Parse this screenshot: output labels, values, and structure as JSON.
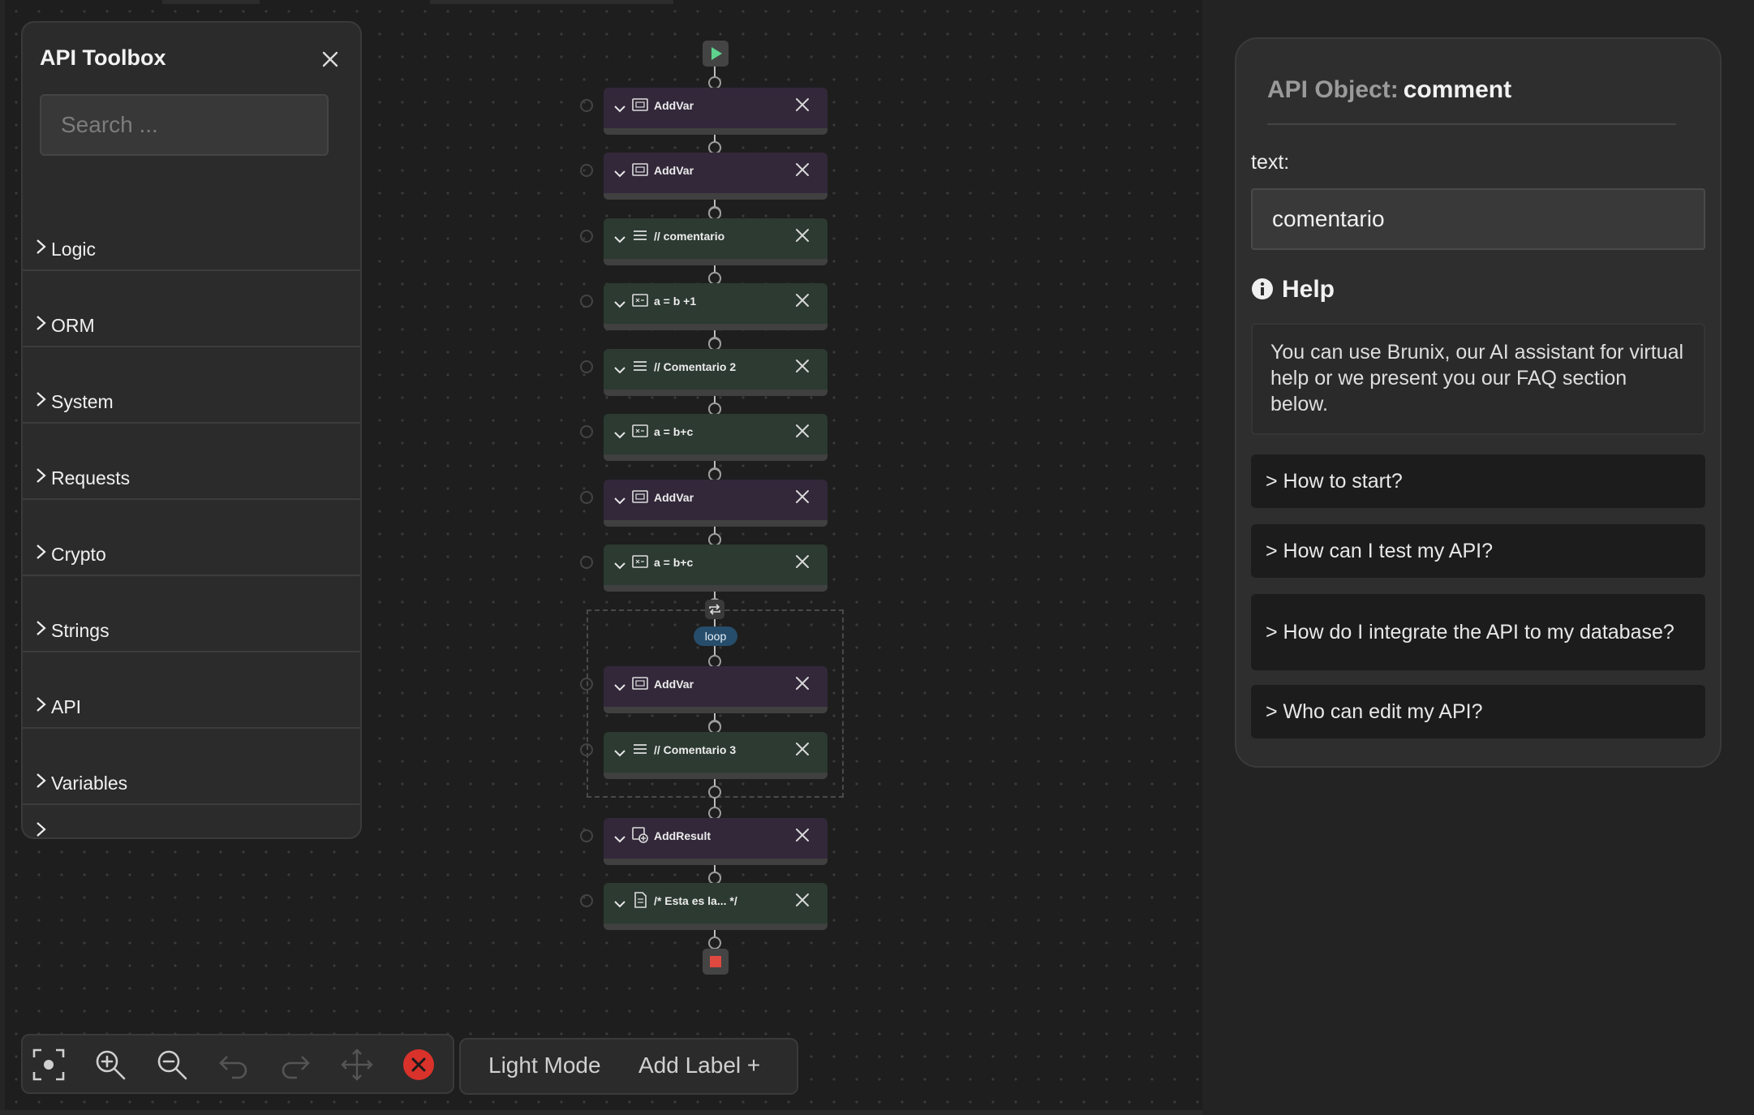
{
  "toolbox": {
    "title": "API Toolbox",
    "search_placeholder": "Search ...",
    "categories": [
      "Logic",
      "ORM",
      "System",
      "Requests",
      "Crypto",
      "Strings",
      "API",
      "Variables"
    ]
  },
  "flow": {
    "loop_label": "loop",
    "nodes": [
      {
        "label": "AddVar",
        "icon": "variable-icon",
        "color": "purple"
      },
      {
        "label": "AddVar",
        "icon": "variable-icon",
        "color": "purple"
      },
      {
        "label": "// comentario",
        "icon": "comment-lines-icon",
        "color": "green"
      },
      {
        "label": "a = b +1",
        "icon": "expression-icon",
        "color": "green"
      },
      {
        "label": "// Comentario 2",
        "icon": "comment-lines-icon",
        "color": "green"
      },
      {
        "label": "a = b+c",
        "icon": "expression-icon",
        "color": "green"
      },
      {
        "label": "AddVar",
        "icon": "variable-icon",
        "color": "purple"
      },
      {
        "label": "a = b+c",
        "icon": "expression-icon",
        "color": "green"
      },
      {
        "label": "AddVar",
        "icon": "variable-icon",
        "color": "purple"
      },
      {
        "label": "// Comentario 3",
        "icon": "comment-lines-icon",
        "color": "green"
      },
      {
        "label": "AddResult",
        "icon": "result-icon",
        "color": "purple"
      },
      {
        "label": "/* Esta es la... */",
        "icon": "document-icon",
        "color": "green"
      }
    ]
  },
  "toolbar": {
    "light_mode": "Light Mode",
    "add_label": "Add Label +"
  },
  "panel": {
    "title_prefix": "API Object:",
    "title_value": "comment",
    "text_label": "text:",
    "text_value": "comentario",
    "help_title": "Help",
    "help_text": "You can use Brunix, our AI assistant for virtual help or we present you our FAQ section below.",
    "faqs": [
      "> How to start?",
      "> How can I test my API?",
      "> How do I integrate the API to my database?",
      "> Who can edit my API?"
    ]
  },
  "colors": {
    "node_purple": "#33283a",
    "node_green": "#2c3a31",
    "loop_pill": "#264d6b",
    "start": "#5fd38d",
    "stop": "#e0493f",
    "delete_all": "#d9322b"
  }
}
